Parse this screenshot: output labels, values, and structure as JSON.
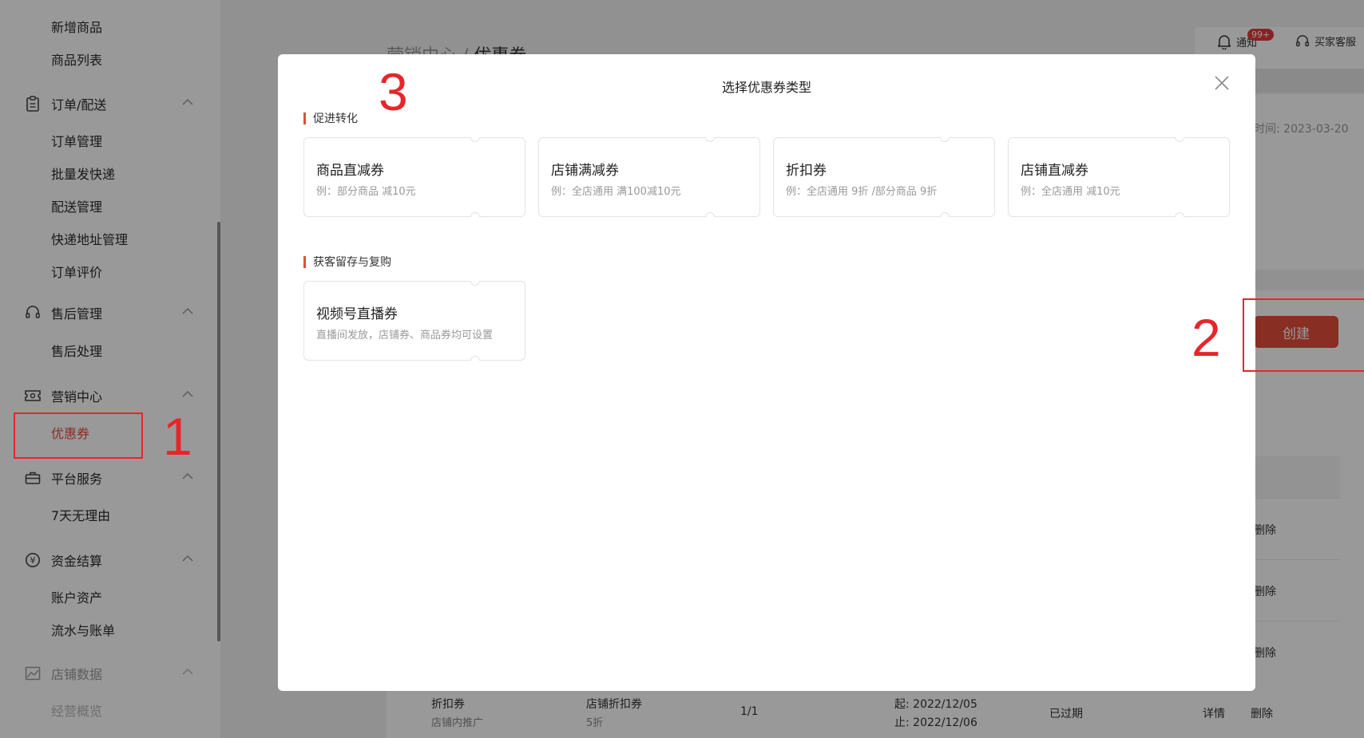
{
  "sidebar": {
    "top_items": [
      "新增商品",
      "商品列表"
    ],
    "groups": [
      {
        "label": "订单/配送",
        "items": [
          "订单管理",
          "批量发快递",
          "配送管理",
          "快递地址管理",
          "订单评价"
        ]
      },
      {
        "label": "售后管理",
        "items": [
          "售后处理"
        ]
      },
      {
        "label": "营销中心",
        "items": [
          "优惠券"
        ]
      },
      {
        "label": "平台服务",
        "items": [
          "7天无理由"
        ]
      },
      {
        "label": "资金结算",
        "items": [
          "账户资产",
          "流水与账单"
        ]
      },
      {
        "label": "店铺数据",
        "items": [
          "经营概览"
        ]
      }
    ],
    "active_item": "优惠券"
  },
  "header": {
    "breadcrumb_parent": "营销中心",
    "breadcrumb_sep": " / ",
    "breadcrumb_current": "优惠券",
    "notify_label": "通知",
    "notify_badge": "99+",
    "service_label": "买家客服"
  },
  "page": {
    "time_fragment": "时间: 2023-03-20",
    "create_button": "创建",
    "row_action": "删除",
    "bottom_row": {
      "name": "折扣券",
      "name_sub": "店铺内推广",
      "type": "店铺折扣券",
      "type_sub": "5折",
      "count": "1/1",
      "start": "起: 2022/12/05",
      "end": "止: 2022/12/06",
      "status": "已过期",
      "detail": "详情",
      "delete": "删除"
    }
  },
  "modal": {
    "title": "选择优惠券类型",
    "sections": [
      {
        "title": "促进转化",
        "cards": [
          {
            "title": "商品直减券",
            "desc": "例：部分商品 减10元"
          },
          {
            "title": "店铺满减券",
            "desc": "例：全店通用 满100减10元"
          },
          {
            "title": "折扣券",
            "desc": "例：全店通用 9折 /部分商品 9折"
          },
          {
            "title": "店铺直减券",
            "desc": "例：全店通用 减10元"
          }
        ]
      },
      {
        "title": "获客留存与复购",
        "cards": [
          {
            "title": "视频号直播券",
            "desc": "直播间发放，店铺券、商品券均可设置"
          }
        ]
      }
    ]
  },
  "annotations": [
    "1",
    "2",
    "3"
  ],
  "colors": {
    "accent": "#e44d3a",
    "annotation": "#e6262b"
  }
}
